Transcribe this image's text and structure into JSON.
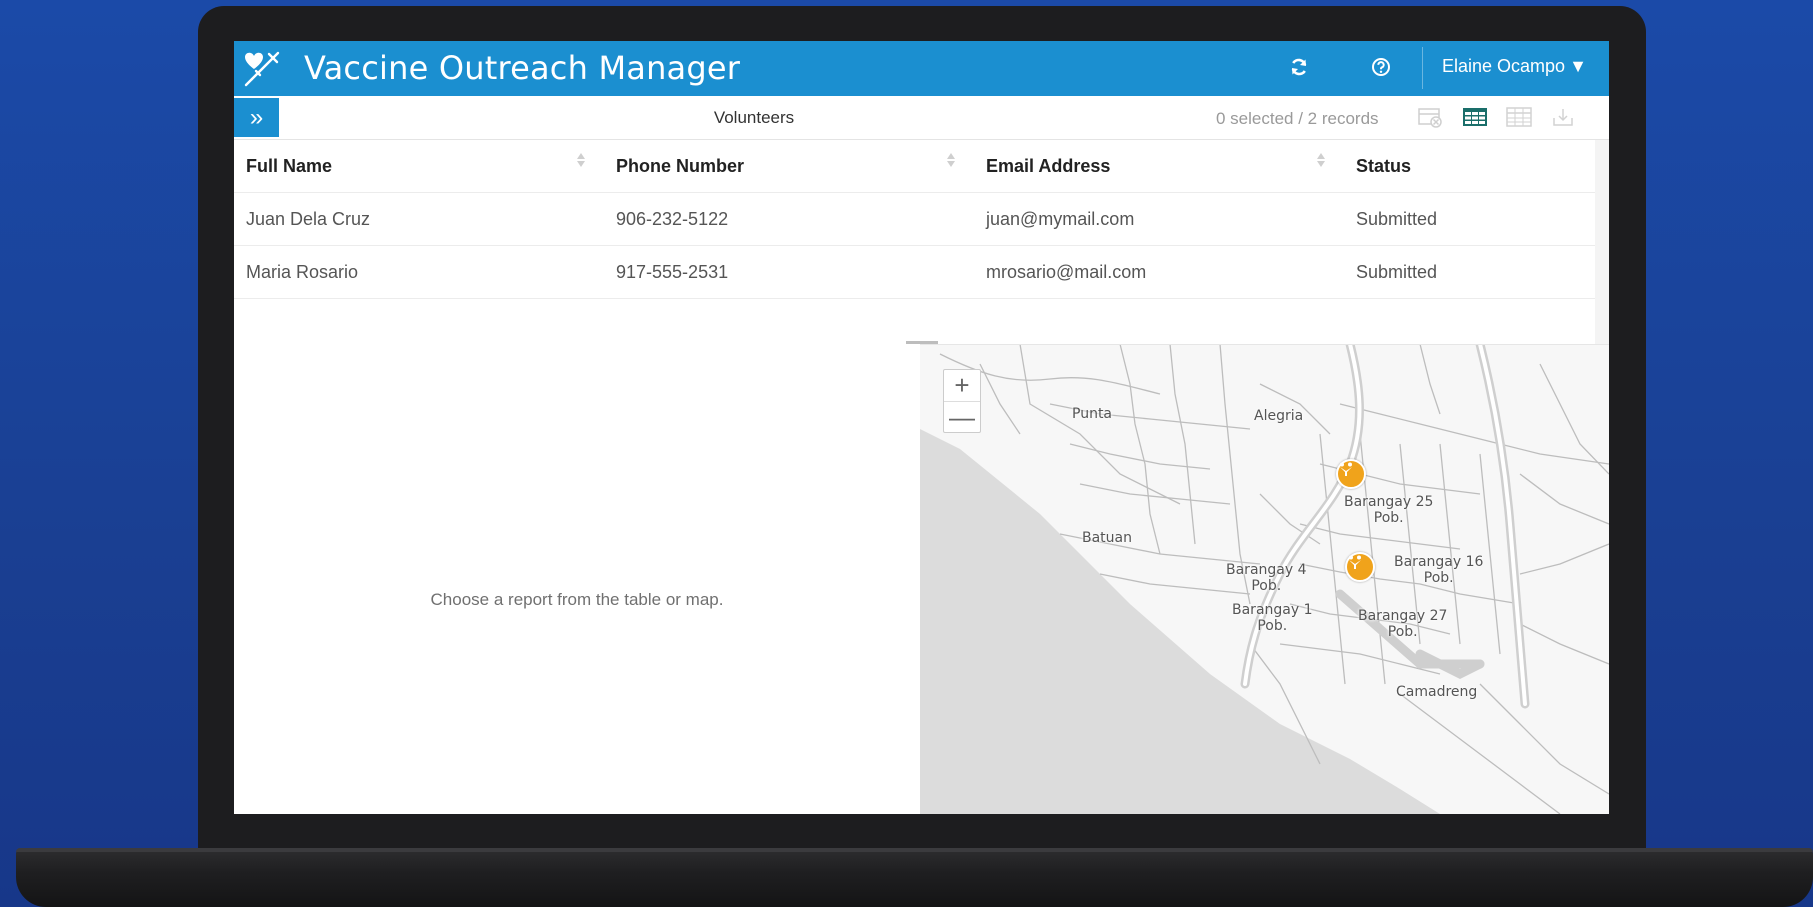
{
  "app": {
    "title": "Vaccine Outreach Manager",
    "user": "Elaine Ocampo",
    "user_caret": "▼",
    "accent": "#1b8fd0",
    "icons": [
      "syringe-heart-icon",
      "refresh-icon",
      "help-icon"
    ]
  },
  "toolbar": {
    "expand_label": "»",
    "layer_title": "Volunteers",
    "selection_status": "0 selected / 2 records",
    "icons": [
      "clear-selection-icon",
      "table-view-icon",
      "grid-view-icon",
      "export-icon"
    ]
  },
  "table": {
    "columns": [
      "Full Name",
      "Phone Number",
      "Email Address",
      "Status"
    ],
    "rows": [
      [
        "Juan Dela Cruz",
        "906-232-5122",
        "juan@mymail.com",
        "Submitted"
      ],
      [
        "Maria Rosario",
        "917-555-2531",
        "mrosario@mail.com",
        "Submitted"
      ]
    ]
  },
  "detail": {
    "message": "Choose a report from the table or map."
  },
  "map": {
    "zoom_in": "+",
    "zoom_out": "—",
    "labels": {
      "punta": "Punta",
      "alegria": "Alegria",
      "batuan": "Batuan",
      "brgy25": "Barangay 25\nPob.",
      "brgy4": "Barangay 4\nPob.",
      "brgy16": "Barangay 16\nPob.",
      "brgy1": "Barangay 1\nPob.",
      "brgy27": "Barangay 27\nPob.",
      "camadreng": "Camadreng"
    },
    "marker_color": "#f0a31b"
  }
}
